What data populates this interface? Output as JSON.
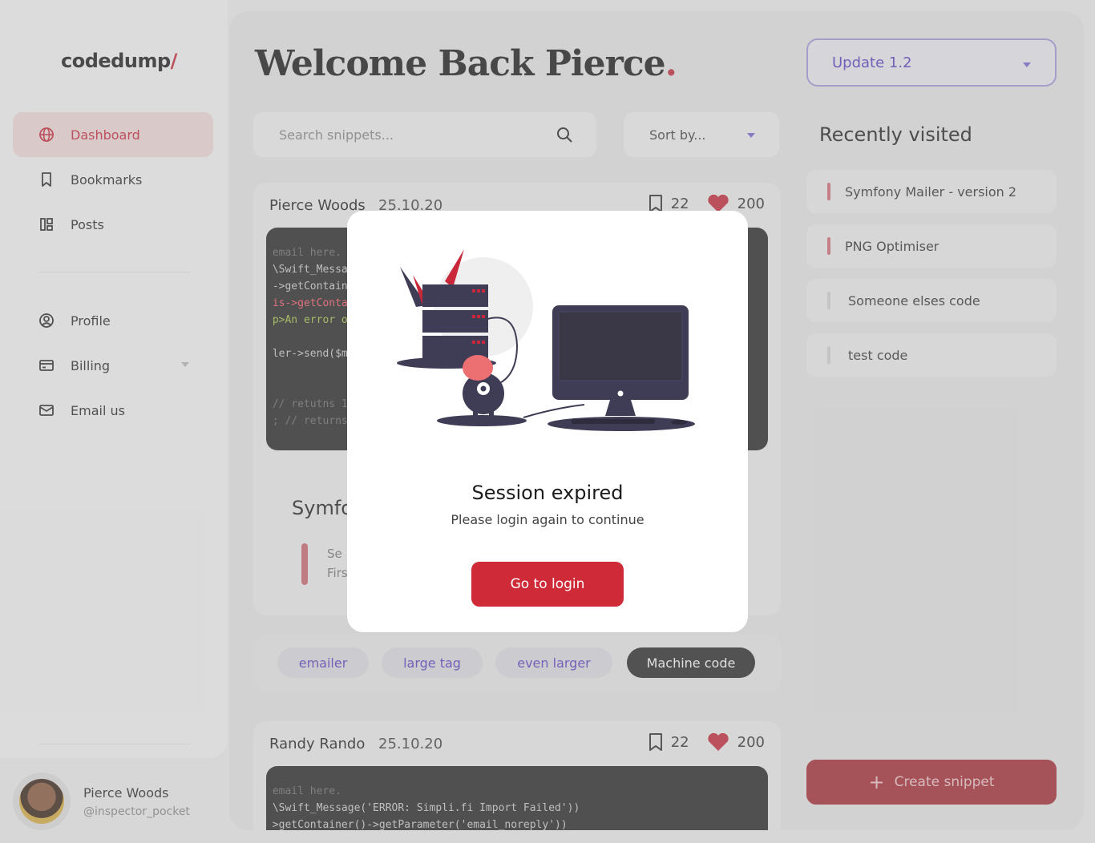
{
  "app": {
    "logo_text": "codedump",
    "logo_slash": "/",
    "welcome_text": "Welcome Back Pierce",
    "welcome_dot": "."
  },
  "sidebar": {
    "items": [
      {
        "label": "Dashboard",
        "icon": "globe-icon",
        "active": true
      },
      {
        "label": "Bookmarks",
        "icon": "bookmark-icon"
      },
      {
        "label": "Posts",
        "icon": "posts-icon"
      },
      {
        "label": "Profile",
        "icon": "user-circle-icon"
      },
      {
        "label": "Billing",
        "icon": "credit-card-icon"
      },
      {
        "label": "Email us",
        "icon": "mail-icon"
      }
    ]
  },
  "user": {
    "name": "Pierce Woods",
    "handle": "@inspector_pocket"
  },
  "header": {
    "update_select": "Update 1.2",
    "search_placeholder": "Search snippets...",
    "sort_label": "Sort by..."
  },
  "recent": {
    "title": "Recently visited",
    "items": [
      {
        "label": "Symfony Mailer - version 2",
        "color": "#d8707a"
      },
      {
        "label": "PNG Optimiser",
        "color": "#d8707a"
      },
      {
        "label": "Someone elses code",
        "color": "#d6d6d6"
      },
      {
        "label": "test code",
        "color": "#d6d6d6"
      }
    ]
  },
  "create_button": "Create snippet",
  "cards": [
    {
      "author": "Pierce Woods",
      "date": "25.10.20",
      "bookmarks": "22",
      "likes": "200",
      "code_lines": [
        "",
        " email here.",
        " \\Swift_Messa",
        " ->getContaine",
        " is->getContai",
        " p>An error o",
        "",
        " ler->send($me",
        "",
        "",
        " // retutns 1",
        " ; // returns"
      ]
    },
    {
      "author": "Randy Rando",
      "date": "25.10.20",
      "bookmarks": "22",
      "likes": "200",
      "code_lines": [
        "",
        " email here.",
        " \\Swift_Message('ERROR: Simpli.fi Import Failed'))",
        " >getContainer()->getParameter('email_noreply'))"
      ]
    }
  ],
  "card_fragments": {
    "symfony_title": "Symfo",
    "symfony_line1": "Se",
    "symfony_line2": "Firs"
  },
  "tags": [
    "emailer",
    "large tag",
    "even larger",
    "Machine code"
  ],
  "modal": {
    "title": "Session expired",
    "subtitle": "Please login again to continue",
    "button": "Go to login"
  },
  "colors": {
    "accent": "#cf2a37",
    "purple": "#5b3fc4"
  }
}
